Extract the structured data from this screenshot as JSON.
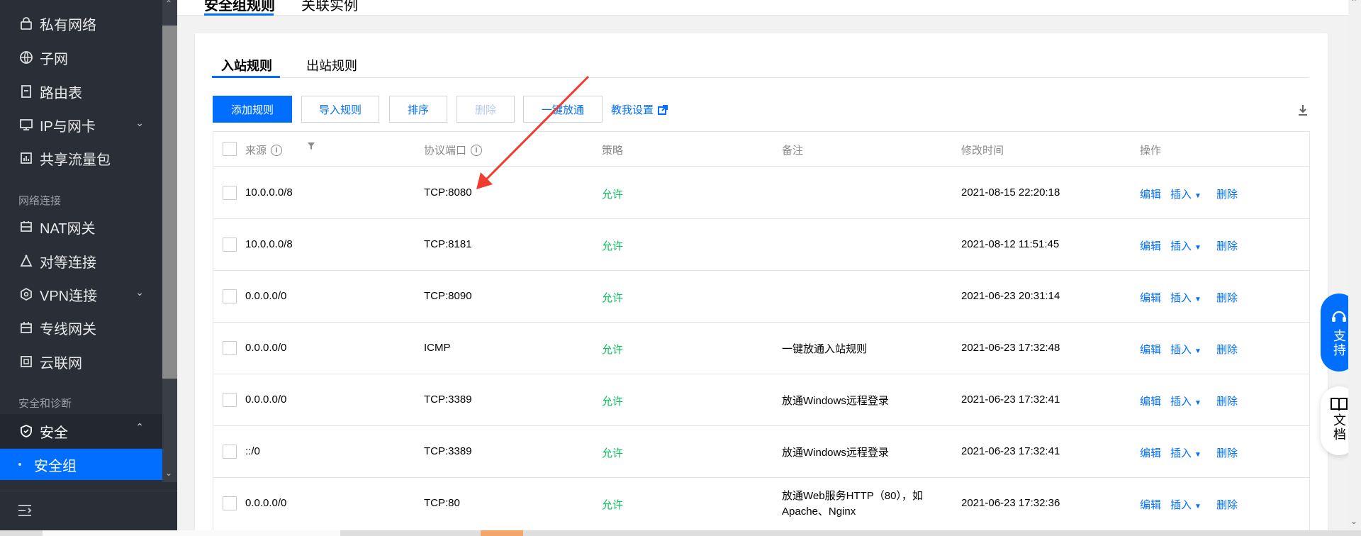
{
  "sidebar": {
    "items_top": [
      {
        "label": "私有网络",
        "icon": "lock-icon"
      },
      {
        "label": "子网",
        "icon": "globe-icon"
      },
      {
        "label": "路由表",
        "icon": "document-icon"
      },
      {
        "label": "IP与网卡",
        "icon": "monitor-icon"
      },
      {
        "label": "共享流量包",
        "icon": "bar-chart-icon"
      }
    ],
    "group_network": "网络连接",
    "items_network": [
      {
        "label": "NAT网关",
        "icon": "gateway-icon"
      },
      {
        "label": "对等连接",
        "icon": "peering-icon"
      },
      {
        "label": "VPN连接",
        "icon": "vpn-icon"
      },
      {
        "label": "专线网关",
        "icon": "dedicated-gateway-icon"
      },
      {
        "label": "云联网",
        "icon": "cloud-network-icon"
      }
    ],
    "group_security": "安全和诊断",
    "security_label": "安全",
    "security_group_label": "安全组"
  },
  "top_tabs": [
    "安全组规则",
    "关联实例"
  ],
  "sub_tabs": [
    "入站规则",
    "出站规则"
  ],
  "toolbar": {
    "add": "添加规则",
    "import": "导入规则",
    "sort": "排序",
    "delete": "删除",
    "one_click": "一键放通",
    "help": "教我设置"
  },
  "table": {
    "headers": {
      "source": "来源",
      "protocol_port": "协议端口",
      "policy": "策略",
      "remark": "备注",
      "modified": "修改时间",
      "actions": "操作"
    },
    "action_labels": {
      "edit": "编辑",
      "insert": "插入",
      "delete": "删除"
    },
    "rows": [
      {
        "source": "10.0.0.0/8",
        "port": "TCP:8080",
        "policy": "允许",
        "remark": "",
        "remark2": "",
        "time": "2021-08-15 22:20:18"
      },
      {
        "source": "10.0.0.0/8",
        "port": "TCP:8181",
        "policy": "允许",
        "remark": "",
        "remark2": "",
        "time": "2021-08-12 11:51:45"
      },
      {
        "source": "0.0.0.0/0",
        "port": "TCP:8090",
        "policy": "允许",
        "remark": "",
        "remark2": "",
        "time": "2021-06-23 20:31:14"
      },
      {
        "source": "0.0.0.0/0",
        "port": "ICMP",
        "policy": "允许",
        "remark": "一键放通入站规则",
        "remark2": "",
        "time": "2021-06-23 17:32:48"
      },
      {
        "source": "0.0.0.0/0",
        "port": "TCP:3389",
        "policy": "允许",
        "remark": "放通Windows远程登录",
        "remark2": "",
        "time": "2021-06-23 17:32:41"
      },
      {
        "source": "::/0",
        "port": "TCP:3389",
        "policy": "允许",
        "remark": "放通Windows远程登录",
        "remark2": "",
        "time": "2021-06-23 17:32:41"
      },
      {
        "source": "0.0.0.0/0",
        "port": "TCP:80",
        "policy": "允许",
        "remark": "放通Web服务HTTP（80），如",
        "remark2": "Apache、Nginx",
        "time": "2021-06-23 17:32:36"
      }
    ]
  },
  "float": {
    "support": "支持",
    "docs": "文档"
  },
  "colors": {
    "accent": "#006eff",
    "allow": "#0abf5b",
    "sidebar_bg": "#292e37",
    "annotation_arrow": "#f03c2e"
  }
}
